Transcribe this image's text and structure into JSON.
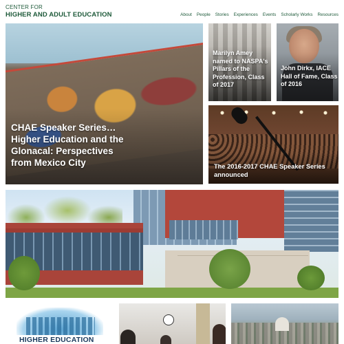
{
  "site": {
    "logo_line1": "CENTER FOR",
    "logo_line2": "HIGHER AND ADULT EDUCATION"
  },
  "nav": {
    "items": [
      "About",
      "People",
      "Stories",
      "Experiences",
      "Events",
      "Scholarly Works",
      "Resources"
    ]
  },
  "tiles": {
    "main": {
      "title": "CHAE Speaker Series… Higher Education and the Glonacal: Perspectives from Mexico City"
    },
    "marilyn": {
      "title": "Marilyn Amey named to NASPA's Pillars of the Profession, Class of 2017"
    },
    "john": {
      "title": "John Dirkx, IACE Hall of Fame, Class of 2016"
    },
    "speaker": {
      "title": "The 2016-2017 CHAE Speaker Series announced"
    },
    "bottom_left": {
      "label": "HIGHER EDUCATION"
    }
  },
  "colors": {
    "brand_green": "#1e5a3a",
    "tile_text": "#ffffff"
  }
}
